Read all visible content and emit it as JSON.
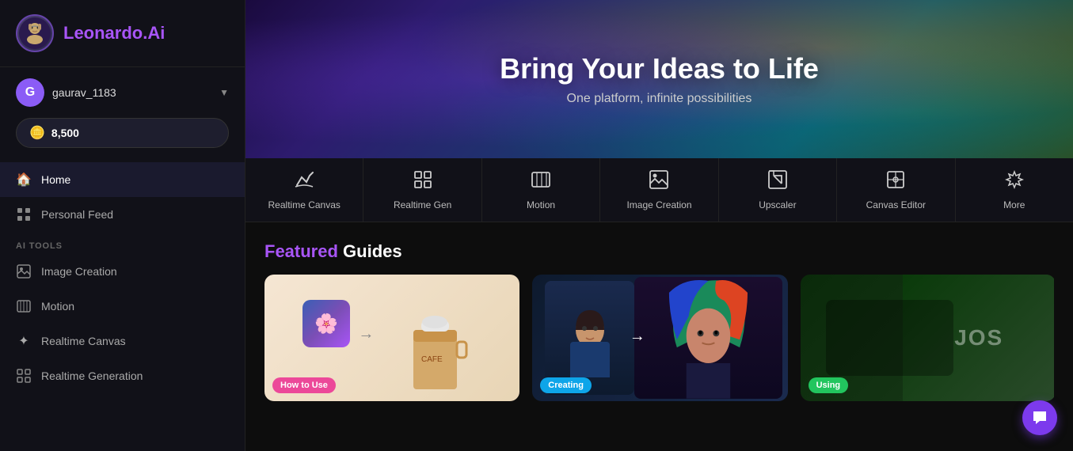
{
  "sidebar": {
    "logo_text": "Leonardo",
    "logo_accent": ".Ai",
    "user": {
      "initial": "G",
      "name": "gaurav_1183",
      "credits": "8,500"
    },
    "nav_items": [
      {
        "id": "home",
        "label": "Home",
        "icon": "🏠",
        "active": true
      },
      {
        "id": "personal-feed",
        "label": "Personal Feed",
        "icon": "⊞"
      }
    ],
    "section_label": "AI Tools",
    "tools": [
      {
        "id": "image-creation",
        "label": "Image Creation",
        "icon": "🖼"
      },
      {
        "id": "motion",
        "label": "Motion",
        "icon": "🎬"
      },
      {
        "id": "realtime-canvas",
        "label": "Realtime Canvas",
        "icon": "✦"
      },
      {
        "id": "realtime-gen",
        "label": "Realtime Generation",
        "icon": "⊞"
      }
    ]
  },
  "hero": {
    "title": "Bring Your Ideas to Life",
    "subtitle": "One platform, infinite possibilities"
  },
  "tool_nav": [
    {
      "id": "realtime-canvas",
      "label": "Realtime Canvas",
      "icon": "✏"
    },
    {
      "id": "realtime-gen",
      "label": "Realtime Gen",
      "icon": "⊞"
    },
    {
      "id": "motion",
      "label": "Motion",
      "icon": "🎬"
    },
    {
      "id": "image-creation",
      "label": "Image Creation",
      "icon": "🖼"
    },
    {
      "id": "upscaler",
      "label": "Upscaler",
      "icon": "⬜"
    },
    {
      "id": "canvas-editor",
      "label": "Canvas Editor",
      "icon": "⬡"
    },
    {
      "id": "more",
      "label": "More",
      "icon": "✦"
    }
  ],
  "featured": {
    "title_highlight": "Featured",
    "title_rest": " Guides",
    "cards": [
      {
        "id": "card-1",
        "label": "How to Use",
        "label_color": "label-pink"
      },
      {
        "id": "card-2",
        "label": "Creating",
        "label_color": "label-teal"
      },
      {
        "id": "card-3",
        "label": "Using",
        "label_color": "label-green"
      }
    ]
  }
}
